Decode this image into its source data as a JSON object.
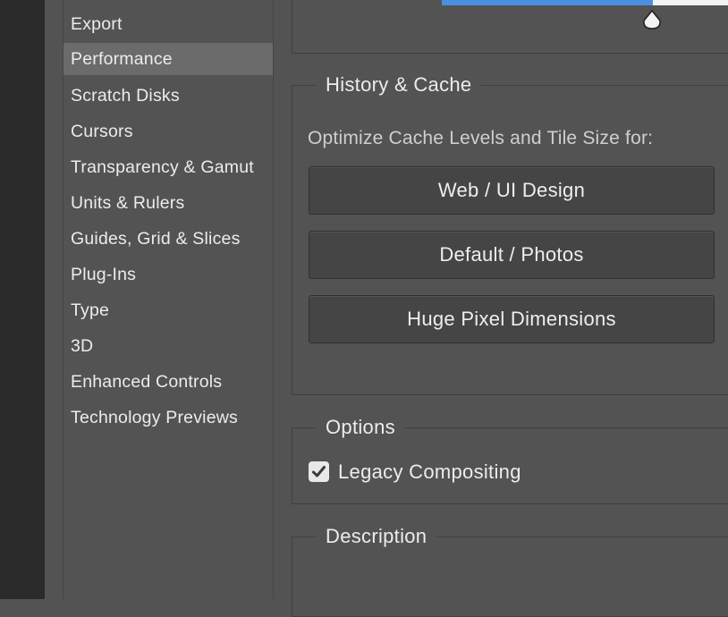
{
  "sidebar": {
    "items": [
      {
        "label": "Export"
      },
      {
        "label": "Performance",
        "selected": true
      },
      {
        "label": "Scratch Disks"
      },
      {
        "label": "Cursors"
      },
      {
        "label": "Transparency & Gamut"
      },
      {
        "label": "Units & Rulers"
      },
      {
        "label": "Guides, Grid & Slices"
      },
      {
        "label": "Plug-Ins"
      },
      {
        "label": "Type"
      },
      {
        "label": "3D"
      },
      {
        "label": "Enhanced Controls"
      },
      {
        "label": "Technology Previews"
      }
    ]
  },
  "history_cache": {
    "title": "History & Cache",
    "optimize_label": "Optimize Cache Levels and Tile Size for:",
    "buttons": {
      "web_ui": "Web / UI Design",
      "default_photos": "Default / Photos",
      "huge_pixel": "Huge Pixel Dimensions"
    }
  },
  "options": {
    "title": "Options",
    "legacy_compositing": {
      "label": "Legacy Compositing",
      "checked": true
    }
  },
  "description": {
    "title": "Description"
  },
  "colors": {
    "background": "#535353",
    "selected_item": "#6b6b6b",
    "slider_accent": "#4a8fe0"
  },
  "icons": {
    "slider_thumb": "slider-thumb-icon",
    "checkmark": "checkmark-icon"
  }
}
